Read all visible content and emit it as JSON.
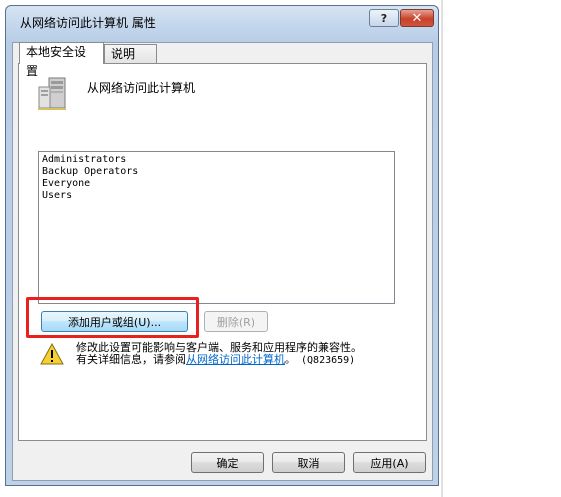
{
  "window": {
    "title": "从网络访问此计算机 属性",
    "help_label": "?",
    "close_label": "✕"
  },
  "tabs": [
    {
      "label": "本地安全设置"
    },
    {
      "label": "说明"
    }
  ],
  "policy": {
    "name": "从网络访问此计算机",
    "icon": "server-icon"
  },
  "members": [
    "Administrators",
    "Backup Operators",
    "Everyone",
    "Users"
  ],
  "buttons": {
    "add": "添加用户或组(U)...",
    "remove": "删除(R)",
    "ok": "确定",
    "cancel": "取消",
    "apply": "应用(A)"
  },
  "warning": {
    "icon": "warning-icon",
    "line1": "修改此设置可能影响与客户端、服务和应用程序的兼容性。",
    "line2_prefix": "有关详细信息，请参阅",
    "link": "从网络访问此计算机",
    "kb": "。 (Q823659)"
  },
  "colors": {
    "highlight": "#e8201e",
    "link": "#0066cc",
    "title_bar": "#c3d6ec"
  }
}
